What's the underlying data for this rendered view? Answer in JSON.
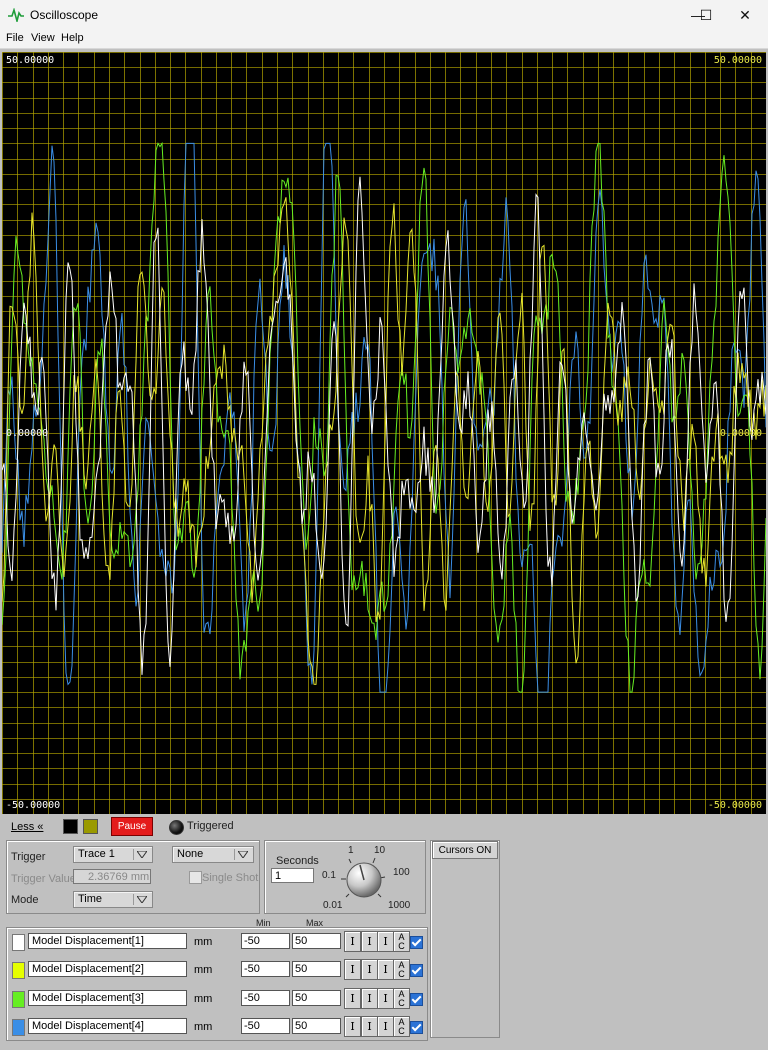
{
  "window": {
    "title": "Oscilloscope",
    "minimize": "—",
    "maximize": "☐",
    "close": "✕"
  },
  "menu": [
    "File",
    "View",
    "Help"
  ],
  "scope": {
    "y_max_label": "50.00000",
    "y_mid_label": "0.00000",
    "y_min_label": "-50.00000",
    "grid_color": "#b8a800",
    "background": "#000000"
  },
  "chart_data": {
    "type": "line",
    "ylim": [
      -50,
      50
    ],
    "series": [
      {
        "name": "Model Displacement[1]",
        "color": "#ffffff"
      },
      {
        "name": "Model Displacement[2]",
        "color": "#e6e62e"
      },
      {
        "name": "Model Displacement[3]",
        "color": "#66ee22"
      },
      {
        "name": "Model Displacement[4]",
        "color": "#3a8ee6"
      }
    ]
  },
  "controls": {
    "less_label": "Less «",
    "pause_label": "Pause",
    "triggered_label": "Triggered",
    "swatch_colors": [
      "#000000",
      "#9a9a00"
    ]
  },
  "trigger": {
    "trigger_label": "Trigger",
    "trigger_source": "Trace 1",
    "slope": "None",
    "value_label": "Trigger Value",
    "value": "2.36769 mm",
    "single_shot_label": "Single Shot",
    "mode_label": "Mode",
    "mode": "Time"
  },
  "timebase": {
    "label": "Seconds",
    "value": "1",
    "knob_labels": {
      "t1": "1",
      "t10": "10",
      "t01": "0.1",
      "t100": "100",
      "t001": "0.01",
      "t1000": "1000"
    }
  },
  "cursors": {
    "label": "Cursors ON"
  },
  "table": {
    "min_header": "Min",
    "max_header": "Max"
  },
  "traces": [
    {
      "name": "Model Displacement[1]",
      "unit": "mm",
      "min": "-50",
      "max": "50",
      "color": "#ffffff",
      "enabled": true
    },
    {
      "name": "Model Displacement[2]",
      "unit": "mm",
      "min": "-50",
      "max": "50",
      "color": "#e6ff00",
      "enabled": true
    },
    {
      "name": "Model Displacement[3]",
      "unit": "mm",
      "min": "-50",
      "max": "50",
      "color": "#66ee22",
      "enabled": true
    },
    {
      "name": "Model Displacement[4]",
      "unit": "mm",
      "min": "-50",
      "max": "50",
      "color": "#3a8ee6",
      "enabled": true
    }
  ],
  "trace_buttons": {
    "b1": "I",
    "b2": "I",
    "b3": "I",
    "ac_top": "A",
    "ac_bottom": "C"
  }
}
